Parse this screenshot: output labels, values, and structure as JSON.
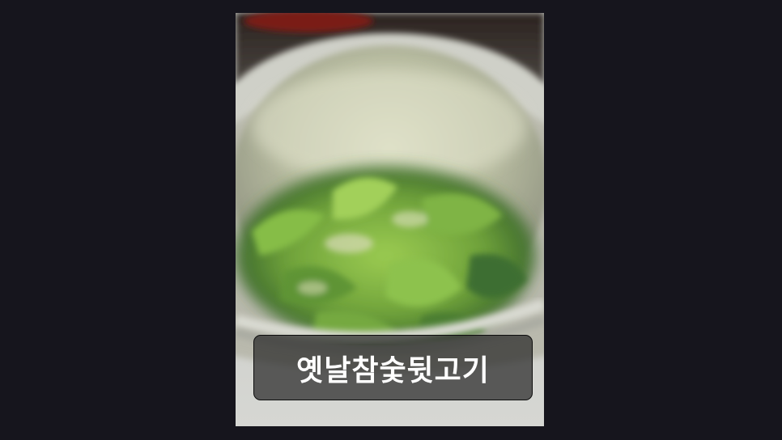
{
  "caption": {
    "text": "옛날참숯뒷고기"
  },
  "colors": {
    "background": "#16151d",
    "caption_text": "#ffffff",
    "caption_box": "#282828"
  }
}
